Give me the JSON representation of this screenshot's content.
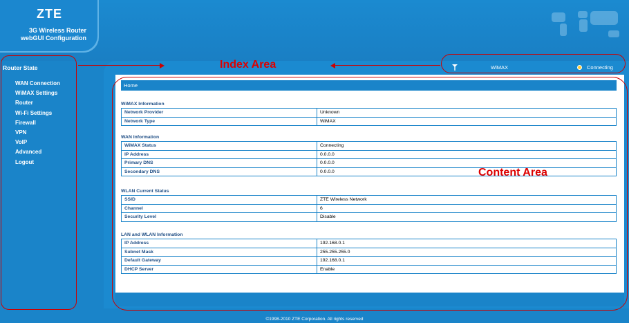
{
  "header": {
    "logo": "ZTE",
    "subtitle_line1": "3G Wireless Router",
    "subtitle_line2": "webGUI Configuration"
  },
  "sidebar": {
    "title": "Router State",
    "items": [
      {
        "label": "WAN Connection"
      },
      {
        "label": "WiMAX Settings"
      },
      {
        "label": "Router"
      },
      {
        "label": "Wi-Fi Settings"
      },
      {
        "label": "Firewall"
      },
      {
        "label": "VPN"
      },
      {
        "label": "VoIP"
      },
      {
        "label": "Advanced"
      },
      {
        "label": "Logout"
      }
    ]
  },
  "status": {
    "network": "WiMAX",
    "connection": "Connecting"
  },
  "annotations": {
    "index_area": "Index Area",
    "content_area": "Content Area"
  },
  "content": {
    "breadcrumb": "Home",
    "sections": [
      {
        "title": "WiMAX Information",
        "rows": [
          {
            "k": "Network Provider",
            "v": "Unknown"
          },
          {
            "k": "Network Type",
            "v": "WiMAX"
          }
        ]
      },
      {
        "title": "WAN Information",
        "rows": [
          {
            "k": "WiMAX Status",
            "v": "Connecting"
          },
          {
            "k": "IP Address",
            "v": "0.0.0.0"
          },
          {
            "k": "Primary DNS",
            "v": "0.0.0.0"
          },
          {
            "k": "Secondary DNS",
            "v": "0.0.0.0"
          }
        ]
      },
      {
        "title": "WLAN Current Status",
        "rows": [
          {
            "k": "SSID",
            "v": "ZTE Wireless Network"
          },
          {
            "k": "Channel",
            "v": "6"
          },
          {
            "k": "Security Level",
            "v": "Disable"
          }
        ]
      },
      {
        "title": "LAN and WLAN Information",
        "rows": [
          {
            "k": "IP Address",
            "v": "192.168.0.1"
          },
          {
            "k": "Subnet Mask",
            "v": "255.255.255.0"
          },
          {
            "k": "Default Gateway",
            "v": "192.168.0.1"
          },
          {
            "k": "DHCP Server",
            "v": "Enable"
          }
        ]
      }
    ]
  },
  "footer": "©1998-2010 ZTE Corporation. All rights reserved",
  "colors": {
    "background": "#1a84c9",
    "label_text": "#1f4e85",
    "annotation": "#dd0000"
  }
}
